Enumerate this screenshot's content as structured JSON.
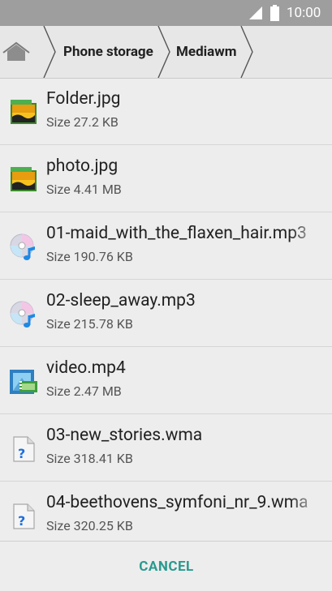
{
  "status_bar": {
    "time": "10:00",
    "signal_icon": "signal-icon",
    "battery_icon": "battery-icon"
  },
  "breadcrumb": {
    "home_icon": "home-icon",
    "items": [
      {
        "label": "Phone storage"
      },
      {
        "label": "Mediawm"
      }
    ]
  },
  "files": [
    {
      "name": "Folder.jpg",
      "size": "Size 27.2 KB",
      "icon": "image-file-icon"
    },
    {
      "name": "photo.jpg",
      "size": "Size 4.41 MB",
      "icon": "image-file-icon"
    },
    {
      "name": "01-maid_with_the_flaxen_hair.mp3",
      "size": "Size 190.76 KB",
      "icon": "audio-file-icon"
    },
    {
      "name": "02-sleep_away.mp3",
      "size": "Size 215.78 KB",
      "icon": "audio-file-icon"
    },
    {
      "name": "video.mp4",
      "size": "Size 2.47 MB",
      "icon": "video-file-icon"
    },
    {
      "name": "03-new_stories.wma",
      "size": "Size 318.41 KB",
      "icon": "unknown-file-icon"
    },
    {
      "name": "04-beethovens_symfoni_nr_9.wma",
      "size": "Size 320.25 KB",
      "icon": "unknown-file-icon"
    }
  ],
  "footer": {
    "cancel_label": "CANCEL"
  },
  "colors": {
    "status_bar": "#9e9e9e",
    "background": "#ededed",
    "accent": "#2a9a8f"
  }
}
